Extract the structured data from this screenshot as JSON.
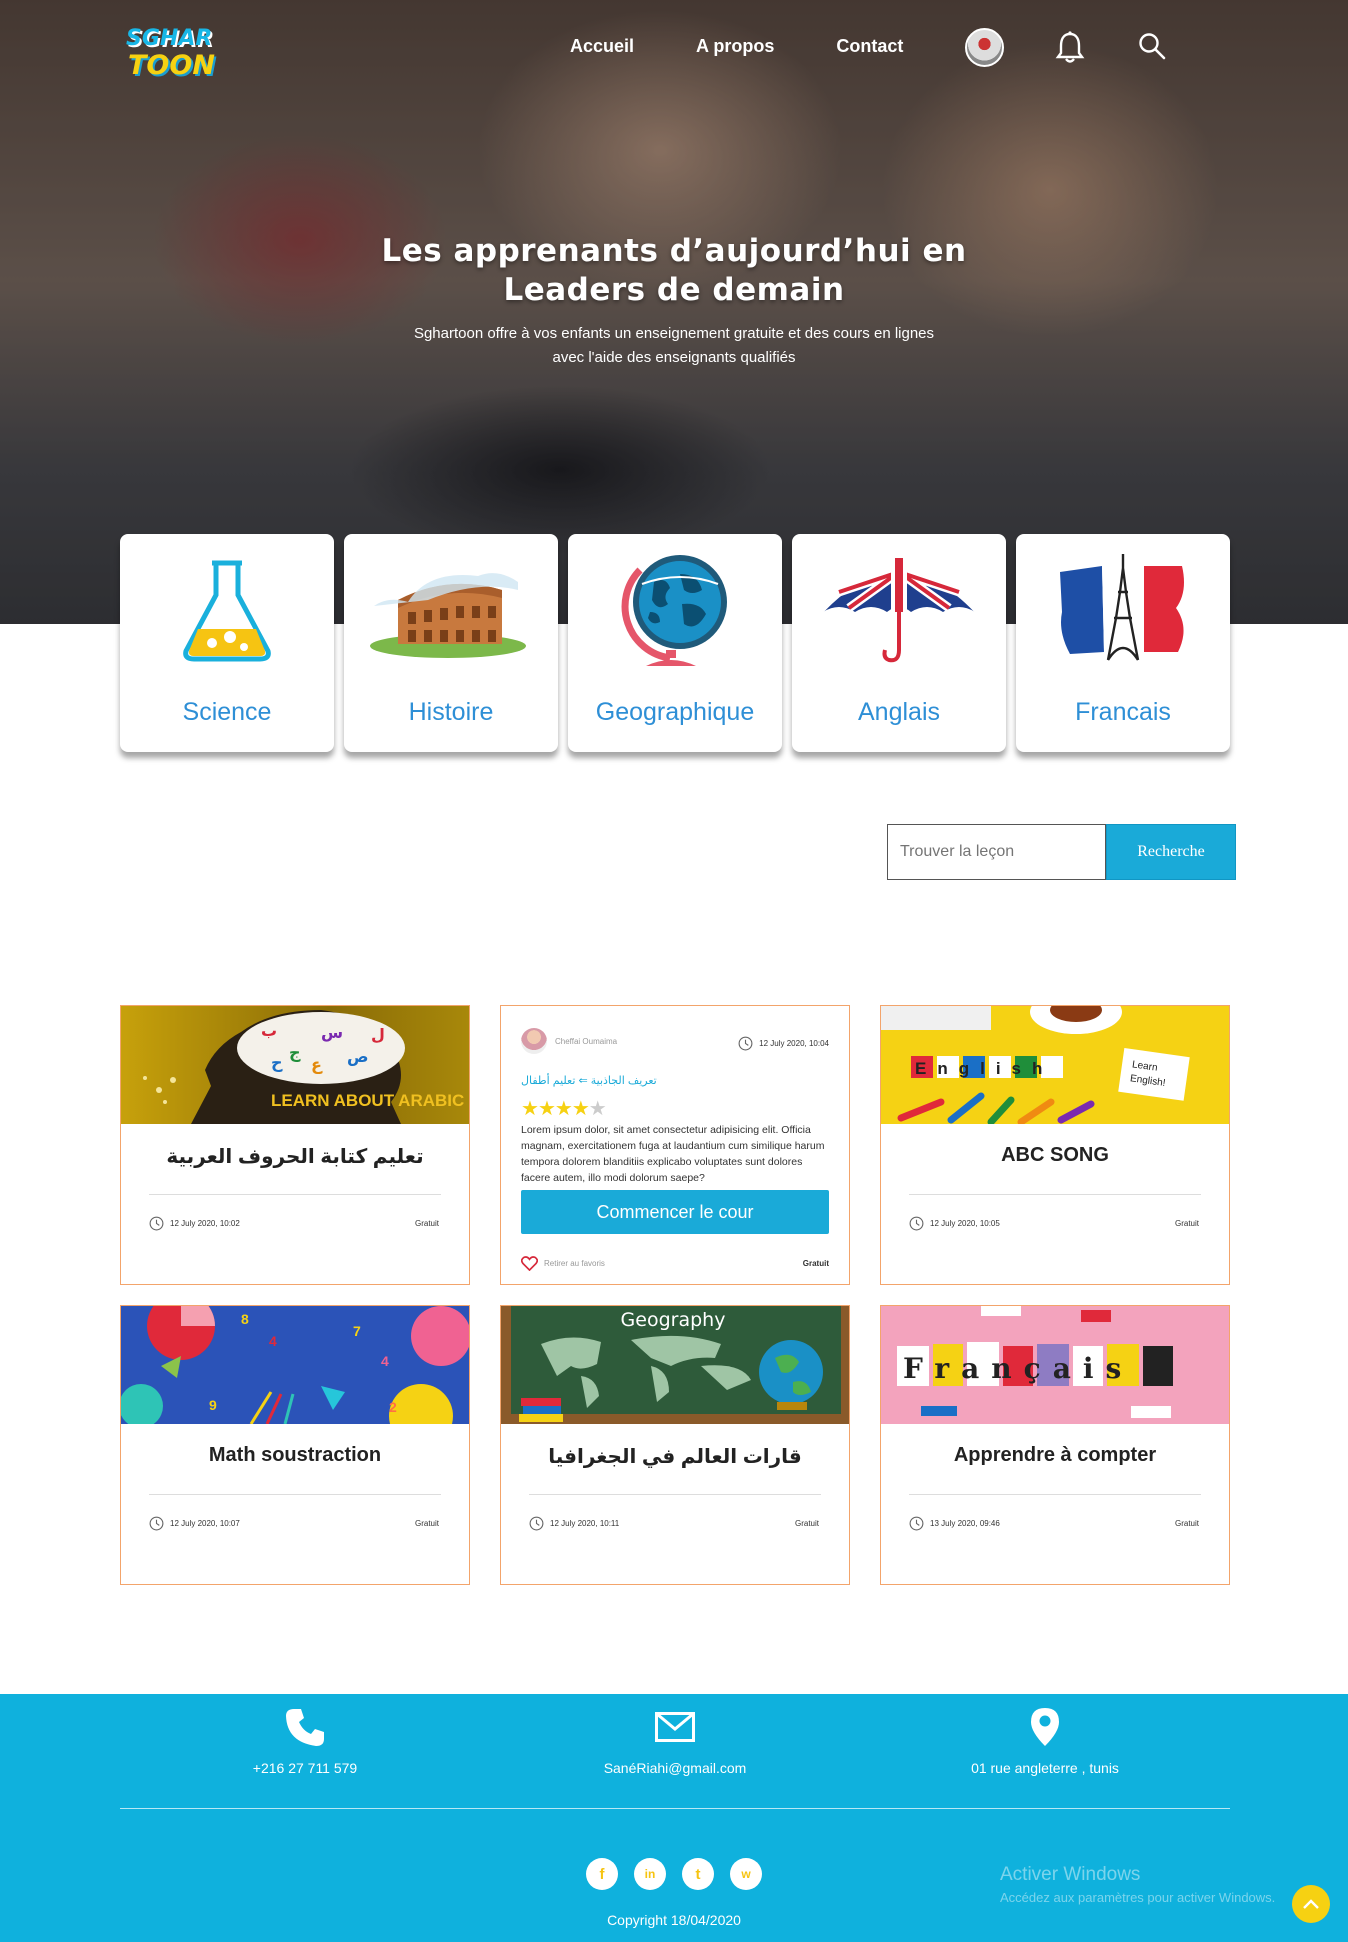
{
  "nav": {
    "logo_top": "SGHAR",
    "logo_bottom": "TOON",
    "links": [
      "Accueil",
      "A propos",
      "Contact"
    ]
  },
  "hero": {
    "title_line1": "Les apprenants d’aujourd’hui en",
    "title_line2": "Leaders de demain",
    "subtitle_line1": "Sghartoon offre à vos enfants un enseignement gratuite et des cours en lignes",
    "subtitle_line2": "avec l'aide des enseignants qualifiés"
  },
  "categories": [
    {
      "label": "Science",
      "icon": "flask-icon"
    },
    {
      "label": "Histoire",
      "icon": "colosseum-icon"
    },
    {
      "label": "Geographique",
      "icon": "globe-icon"
    },
    {
      "label": "Anglais",
      "icon": "uk-umbrella-icon"
    },
    {
      "label": "Francais",
      "icon": "france-eiffel-icon"
    }
  ],
  "search": {
    "placeholder": "Trouver la leçon",
    "button": "Recherche"
  },
  "cards": [
    {
      "title": "تعليم كتابة الحروف العربية",
      "date": "12 July 2020, 10:02",
      "price": "Gratuit",
      "image_text": "LEARN ABOUT ARABIC"
    },
    {
      "expanded": true,
      "author": "Cheffai Oumaima",
      "date": "12 July 2020, 10:04",
      "category": "تعريف الجاذبية ⇐ تعليم أطفال",
      "rating": 4,
      "rating_max": 5,
      "description": "Lorem ipsum dolor, sit amet consectetur adipisicing elit. Officia magnam, exercitationem fuga at laudantium cum similique harum tempora dolorem blanditiis explicabo voluptates sunt dolores facere autem, illo modi dolorum saepe?",
      "button": "Commencer le cour",
      "favorite": "Retirer au favoris",
      "price": "Gratuit"
    },
    {
      "title": "ABC SONG",
      "date": "12 July 2020, 10:05",
      "price": "Gratuit",
      "image_text": "English"
    },
    {
      "title": "Math soustraction",
      "date": "12 July 2020, 10:07",
      "price": "Gratuit"
    },
    {
      "title": "قارات العالم في الجغرافيا",
      "date": "12 July 2020, 10:11",
      "price": "Gratuit",
      "image_text": "Geography"
    },
    {
      "title": "Apprendre à compter",
      "date": "13 July 2020, 09:46",
      "price": "Gratuit",
      "image_text": "Français"
    }
  ],
  "footer": {
    "phone": "+216 27 711 579",
    "email": "SanéRiahi@gmail.com",
    "address": "01 rue angleterre , tunis",
    "socials": [
      "f",
      "in",
      "t",
      "w"
    ],
    "copyright": "Copyright 18/04/2020",
    "watermark_title": "Activer Windows",
    "watermark_sub": "Accédez aux paramètres pour activer Windows."
  },
  "colors": {
    "accent": "#0fb1dd",
    "yellow": "#f6d112",
    "card_border": "#f3a46b",
    "category_text": "#2e8fd6"
  }
}
